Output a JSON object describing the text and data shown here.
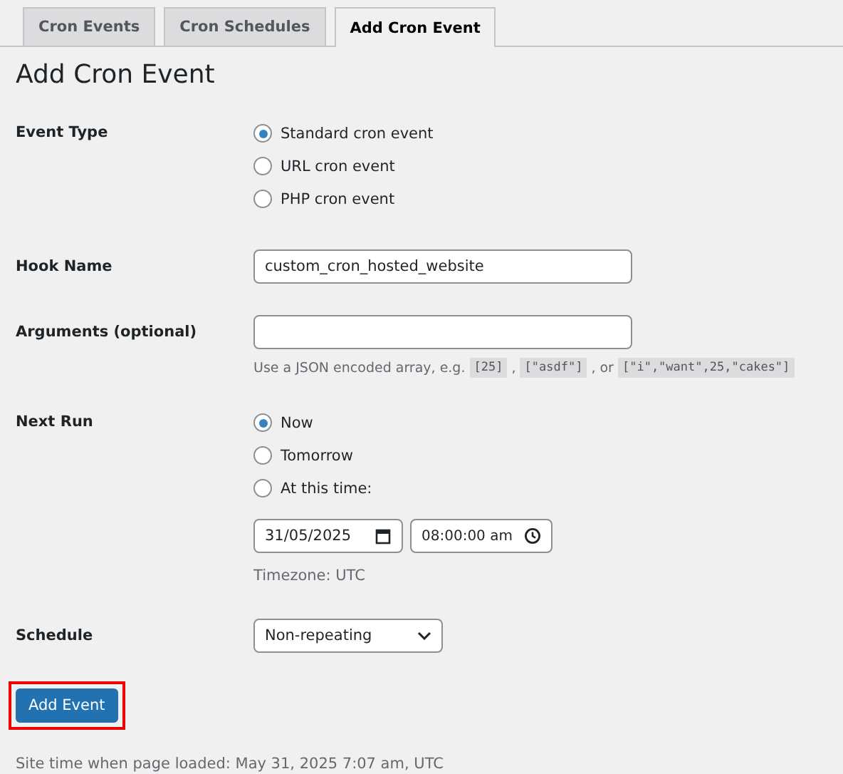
{
  "tabs": [
    {
      "label": "Cron Events",
      "selected": false
    },
    {
      "label": "Cron Schedules",
      "selected": false
    },
    {
      "label": "Add Cron Event",
      "selected": true
    }
  ],
  "heading": "Add Cron Event",
  "event_type": {
    "label": "Event Type",
    "options": [
      {
        "label": "Standard cron event",
        "selected": true
      },
      {
        "label": "URL cron event",
        "selected": false
      },
      {
        "label": "PHP cron event",
        "selected": false
      }
    ]
  },
  "hook_name": {
    "label": "Hook Name",
    "value": "custom_cron_hosted_website"
  },
  "arguments": {
    "label": "Arguments (optional)",
    "hint": [
      {
        "kind": "text",
        "text": "Use a JSON encoded array, e.g."
      },
      {
        "kind": "code",
        "text": "[25]"
      },
      {
        "kind": "text",
        "text": ","
      },
      {
        "kind": "code",
        "text": "[\"asdf\"]"
      },
      {
        "kind": "text",
        "text": ", or"
      },
      {
        "kind": "code",
        "text": "[\"i\",\"want\",25,\"cakes\"]"
      }
    ]
  },
  "next_run": {
    "label": "Next Run",
    "options": [
      {
        "label": "Now",
        "selected": true
      },
      {
        "label": "Tomorrow",
        "selected": false
      },
      {
        "label": "At this time:",
        "selected": false
      }
    ],
    "date": "31/05/2025",
    "time": "08:00:00 am",
    "timezone": "Timezone: UTC"
  },
  "schedule": {
    "label": "Schedule",
    "value": "Non-repeating"
  },
  "submit": {
    "label": "Add Event",
    "highlighted": true
  },
  "footer": "Site time when page loaded: May 31, 2025 7:07 am, UTC"
}
